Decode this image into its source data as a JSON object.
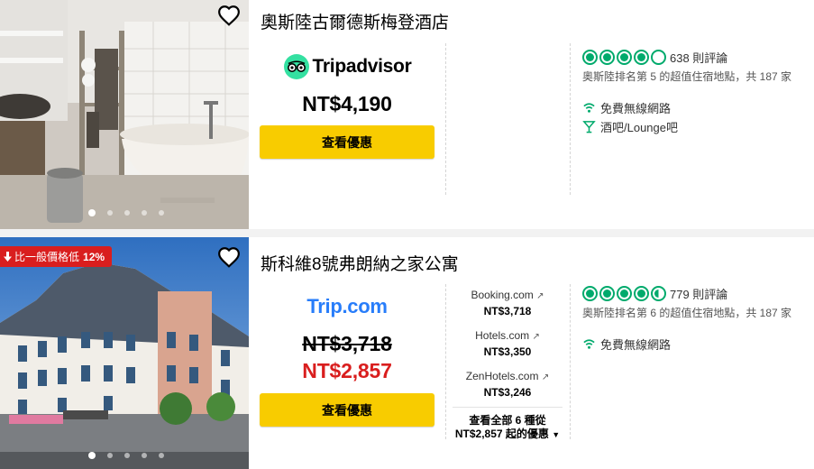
{
  "listings": [
    {
      "name": "奧斯陸古爾德斯梅登酒店",
      "provider_logo": "Tripadvisor",
      "price": "NT$4,190",
      "deal_button": "查看優惠",
      "rating_bubbles": 4,
      "reviews": "638 則評論",
      "rank_text": "奧斯陸排名第 5 的超值住宿地點，共 187 家",
      "amenities": [
        {
          "icon": "wifi-icon",
          "label": "免費無線網路"
        },
        {
          "icon": "cocktail-icon",
          "label": "酒吧/Lounge吧"
        }
      ],
      "photo_dots": 5,
      "active_dot": 0
    },
    {
      "name": "斯科維8號弗朗納之家公寓",
      "badge": {
        "prefix": "比一般價格低",
        "percent": "12%"
      },
      "provider_logo": "Trip.com",
      "old_price": "NT$3,718",
      "price": "NT$2,857",
      "deal_button": "查看優惠",
      "rating_bubbles": 4.5,
      "reviews": "779 則評論",
      "rank_text": "奧斯陸排名第 6 的超值住宿地點，共 187 家",
      "amenities": [
        {
          "icon": "wifi-icon",
          "label": "免費無線網路"
        }
      ],
      "other_providers": [
        {
          "name": "Booking.com",
          "price": "NT$3,718"
        },
        {
          "name": "Hotels.com",
          "price": "NT$3,350"
        },
        {
          "name": "ZenHotels.com",
          "price": "NT$3,246"
        }
      ],
      "view_all_line1": "查看全部 6 種從",
      "view_all_line2": "NT$2,857 起的優惠",
      "photo_dots": 5,
      "active_dot": 0
    }
  ],
  "colors": {
    "accent_green": "#00aa6c",
    "button_yellow": "#f8cc00",
    "discount_red": "#d91e1e"
  }
}
